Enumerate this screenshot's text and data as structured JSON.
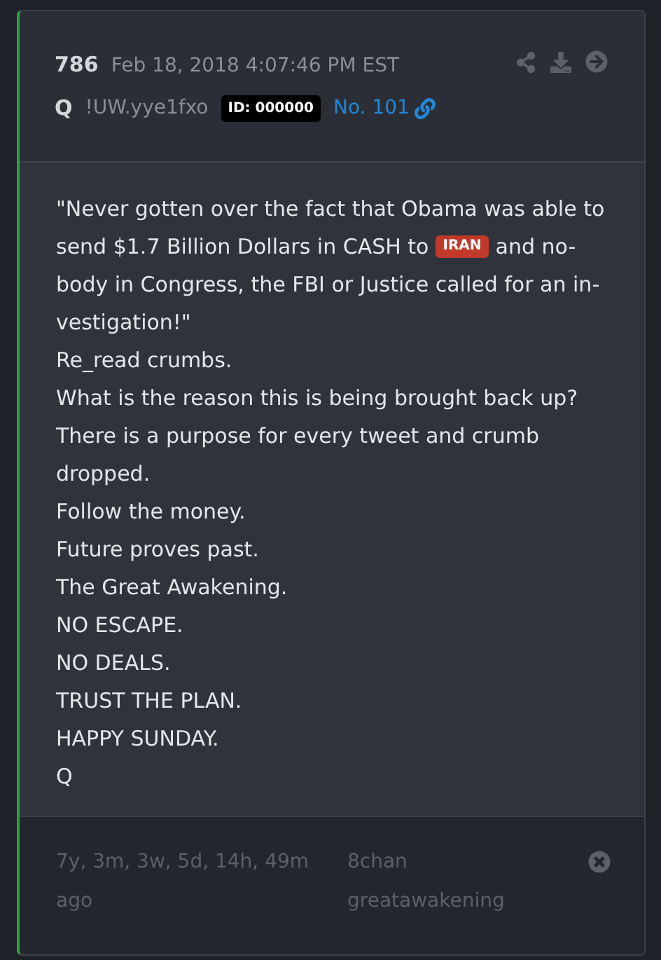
{
  "post": {
    "number": "786",
    "date": "Feb 18, 2018 4:07:46 PM EST",
    "author": "Q",
    "tripcode": "!UW.yye1fxo",
    "id_badge": "ID: 000000",
    "post_link": "No. 101"
  },
  "quote": {
    "lines": [
      {
        "text": "\"Never gotten over the fact that Obama was able to"
      },
      {
        "text": "send $1.7 Billion Dollars in CASH to",
        "tag": "IRAN",
        "after": "and no-"
      },
      {
        "text": "body in Congress, the FBI or Justice called for an in-"
      },
      {
        "text": "vestigation!\""
      }
    ]
  },
  "lines": [
    "Re_read crumbs.",
    "What is the reason this is being brought back up?",
    "There is a purpose for every tweet and crumb dropped.",
    "Follow the money.",
    "Future proves past.",
    "The Great Awakening.",
    "NO ESCAPE.",
    "NO DEALS.",
    "TRUST THE PLAN.",
    "HAPPY SUNDAY.",
    "Q"
  ],
  "footer": {
    "age": "7y, 3m, 3w, 5d, 14h, 49m ago",
    "source": "8chan greatawakening"
  }
}
